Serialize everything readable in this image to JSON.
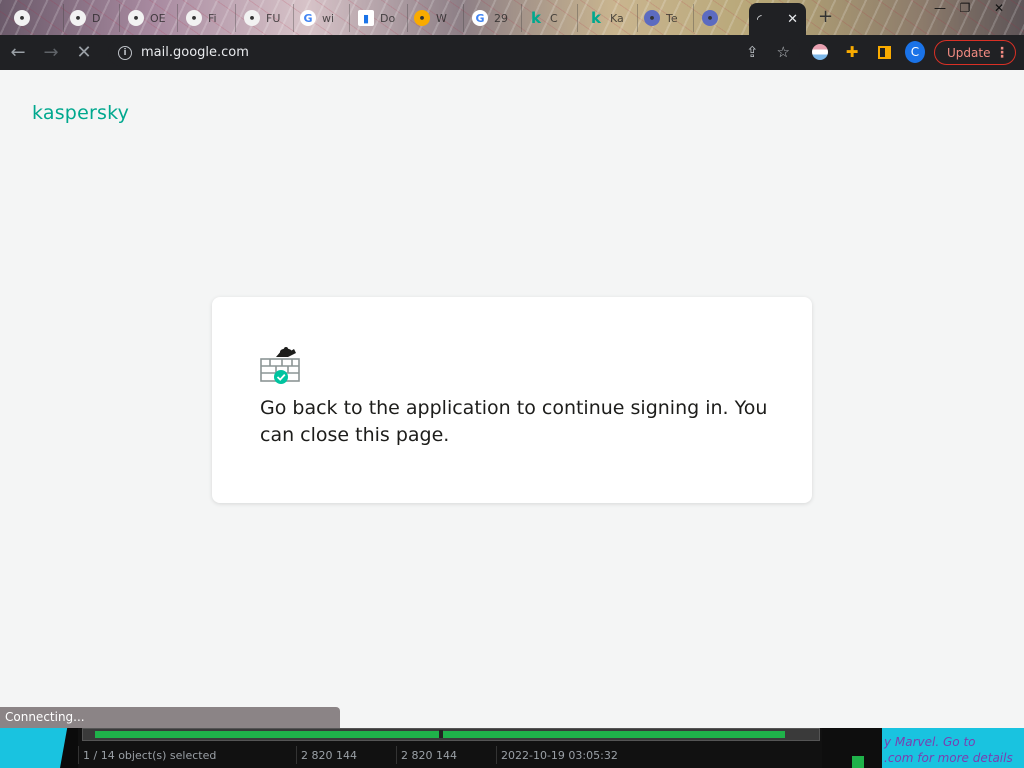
{
  "browser": {
    "tabs": [
      {
        "label": "",
        "icon": "app-icon",
        "color": "#f2f2f2"
      },
      {
        "label": "D",
        "icon": "app-icon",
        "color": "#f2f2f2"
      },
      {
        "label": "OE",
        "icon": "app-icon",
        "color": "#f2f2f2"
      },
      {
        "label": "Fi",
        "icon": "app-icon",
        "color": "#f2f2f2"
      },
      {
        "label": "FU",
        "icon": "app-icon",
        "color": "#f2f2f2"
      },
      {
        "label": "wi",
        "icon": "google-icon",
        "color": "#4285f4"
      },
      {
        "label": "Do",
        "icon": "doc-icon",
        "color": "#1a73e8"
      },
      {
        "label": "W",
        "icon": "app-icon",
        "color": "#f9ab00"
      },
      {
        "label": "29",
        "icon": "google-icon",
        "color": "#4285f4"
      },
      {
        "label": "C",
        "icon": "kaspersky-icon",
        "color": "#00a88e"
      },
      {
        "label": "Ka",
        "icon": "kaspersky-icon",
        "color": "#00a88e"
      },
      {
        "label": "Te",
        "icon": "app-icon",
        "color": "#5c6bc0"
      },
      {
        "label": "",
        "icon": "app-icon",
        "color": "#5c6bc0"
      }
    ],
    "active_tab_close": "✕",
    "new_tab": "+",
    "window_controls": [
      "—",
      "❐",
      "✕"
    ],
    "url": "mail.google.com",
    "profile_initial": "C",
    "update_label": "Update",
    "update_menu": "⋮"
  },
  "page": {
    "logo": "kaspersky",
    "message": "Go back to the application to continue signing in. You can close this page.",
    "accent_color": "#00a88e"
  },
  "status": {
    "text": "Connecting..."
  },
  "taskbar": {
    "selection": "1 / 14 object(s) selected",
    "size1": "2 820 144",
    "size2": "2 820 144",
    "datetime": "2022-10-19 03:05:32",
    "marquee_line1": "y Marvel. Go to",
    "marquee_line2": ".com for more details"
  }
}
